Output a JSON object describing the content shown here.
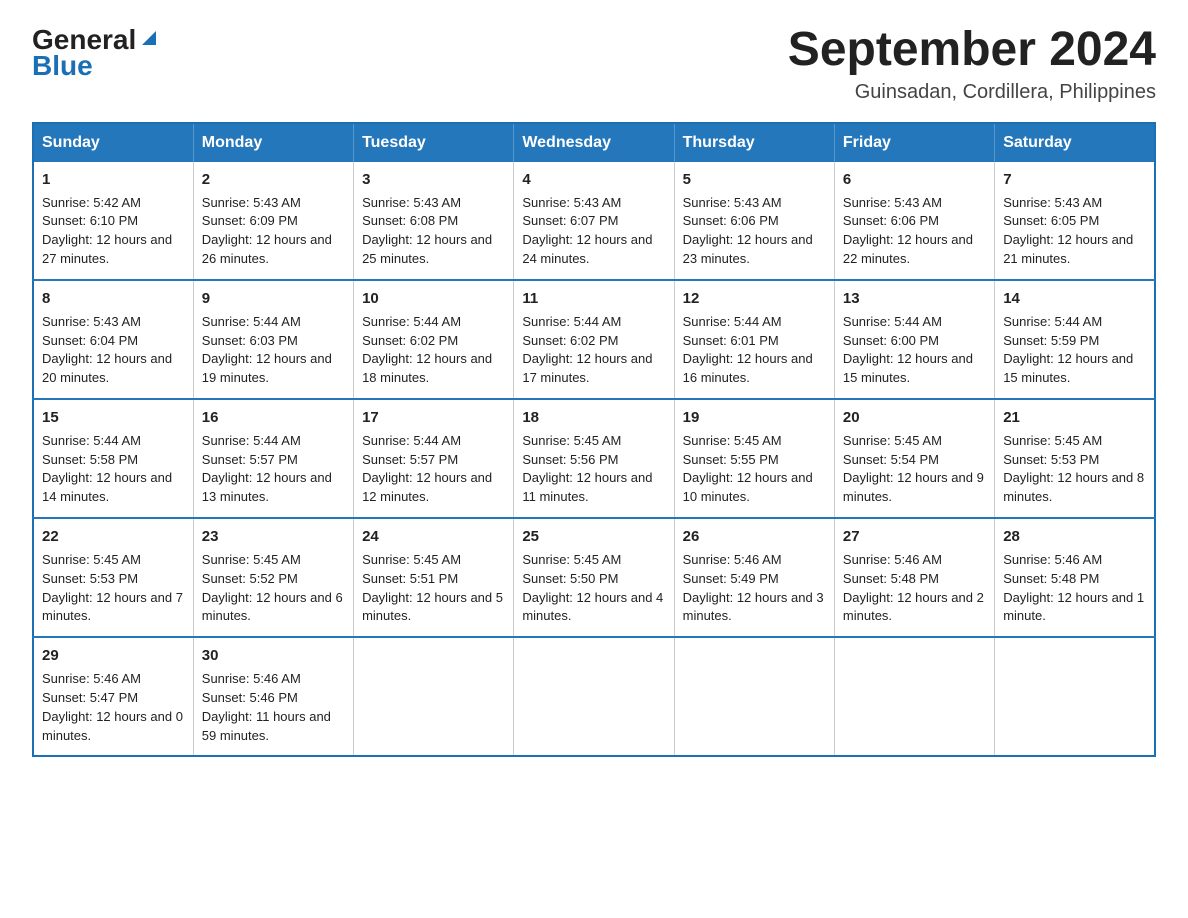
{
  "header": {
    "logo_general": "General",
    "logo_blue": "Blue",
    "title": "September 2024",
    "subtitle": "Guinsadan, Cordillera, Philippines"
  },
  "weekdays": [
    "Sunday",
    "Monday",
    "Tuesday",
    "Wednesday",
    "Thursday",
    "Friday",
    "Saturday"
  ],
  "weeks": [
    [
      {
        "day": "1",
        "sunrise": "5:42 AM",
        "sunset": "6:10 PM",
        "daylight": "12 hours and 27 minutes."
      },
      {
        "day": "2",
        "sunrise": "5:43 AM",
        "sunset": "6:09 PM",
        "daylight": "12 hours and 26 minutes."
      },
      {
        "day": "3",
        "sunrise": "5:43 AM",
        "sunset": "6:08 PM",
        "daylight": "12 hours and 25 minutes."
      },
      {
        "day": "4",
        "sunrise": "5:43 AM",
        "sunset": "6:07 PM",
        "daylight": "12 hours and 24 minutes."
      },
      {
        "day": "5",
        "sunrise": "5:43 AM",
        "sunset": "6:06 PM",
        "daylight": "12 hours and 23 minutes."
      },
      {
        "day": "6",
        "sunrise": "5:43 AM",
        "sunset": "6:06 PM",
        "daylight": "12 hours and 22 minutes."
      },
      {
        "day": "7",
        "sunrise": "5:43 AM",
        "sunset": "6:05 PM",
        "daylight": "12 hours and 21 minutes."
      }
    ],
    [
      {
        "day": "8",
        "sunrise": "5:43 AM",
        "sunset": "6:04 PM",
        "daylight": "12 hours and 20 minutes."
      },
      {
        "day": "9",
        "sunrise": "5:44 AM",
        "sunset": "6:03 PM",
        "daylight": "12 hours and 19 minutes."
      },
      {
        "day": "10",
        "sunrise": "5:44 AM",
        "sunset": "6:02 PM",
        "daylight": "12 hours and 18 minutes."
      },
      {
        "day": "11",
        "sunrise": "5:44 AM",
        "sunset": "6:02 PM",
        "daylight": "12 hours and 17 minutes."
      },
      {
        "day": "12",
        "sunrise": "5:44 AM",
        "sunset": "6:01 PM",
        "daylight": "12 hours and 16 minutes."
      },
      {
        "day": "13",
        "sunrise": "5:44 AM",
        "sunset": "6:00 PM",
        "daylight": "12 hours and 15 minutes."
      },
      {
        "day": "14",
        "sunrise": "5:44 AM",
        "sunset": "5:59 PM",
        "daylight": "12 hours and 15 minutes."
      }
    ],
    [
      {
        "day": "15",
        "sunrise": "5:44 AM",
        "sunset": "5:58 PM",
        "daylight": "12 hours and 14 minutes."
      },
      {
        "day": "16",
        "sunrise": "5:44 AM",
        "sunset": "5:57 PM",
        "daylight": "12 hours and 13 minutes."
      },
      {
        "day": "17",
        "sunrise": "5:44 AM",
        "sunset": "5:57 PM",
        "daylight": "12 hours and 12 minutes."
      },
      {
        "day": "18",
        "sunrise": "5:45 AM",
        "sunset": "5:56 PM",
        "daylight": "12 hours and 11 minutes."
      },
      {
        "day": "19",
        "sunrise": "5:45 AM",
        "sunset": "5:55 PM",
        "daylight": "12 hours and 10 minutes."
      },
      {
        "day": "20",
        "sunrise": "5:45 AM",
        "sunset": "5:54 PM",
        "daylight": "12 hours and 9 minutes."
      },
      {
        "day": "21",
        "sunrise": "5:45 AM",
        "sunset": "5:53 PM",
        "daylight": "12 hours and 8 minutes."
      }
    ],
    [
      {
        "day": "22",
        "sunrise": "5:45 AM",
        "sunset": "5:53 PM",
        "daylight": "12 hours and 7 minutes."
      },
      {
        "day": "23",
        "sunrise": "5:45 AM",
        "sunset": "5:52 PM",
        "daylight": "12 hours and 6 minutes."
      },
      {
        "day": "24",
        "sunrise": "5:45 AM",
        "sunset": "5:51 PM",
        "daylight": "12 hours and 5 minutes."
      },
      {
        "day": "25",
        "sunrise": "5:45 AM",
        "sunset": "5:50 PM",
        "daylight": "12 hours and 4 minutes."
      },
      {
        "day": "26",
        "sunrise": "5:46 AM",
        "sunset": "5:49 PM",
        "daylight": "12 hours and 3 minutes."
      },
      {
        "day": "27",
        "sunrise": "5:46 AM",
        "sunset": "5:48 PM",
        "daylight": "12 hours and 2 minutes."
      },
      {
        "day": "28",
        "sunrise": "5:46 AM",
        "sunset": "5:48 PM",
        "daylight": "12 hours and 1 minute."
      }
    ],
    [
      {
        "day": "29",
        "sunrise": "5:46 AM",
        "sunset": "5:47 PM",
        "daylight": "12 hours and 0 minutes."
      },
      {
        "day": "30",
        "sunrise": "5:46 AM",
        "sunset": "5:46 PM",
        "daylight": "11 hours and 59 minutes."
      },
      null,
      null,
      null,
      null,
      null
    ]
  ]
}
